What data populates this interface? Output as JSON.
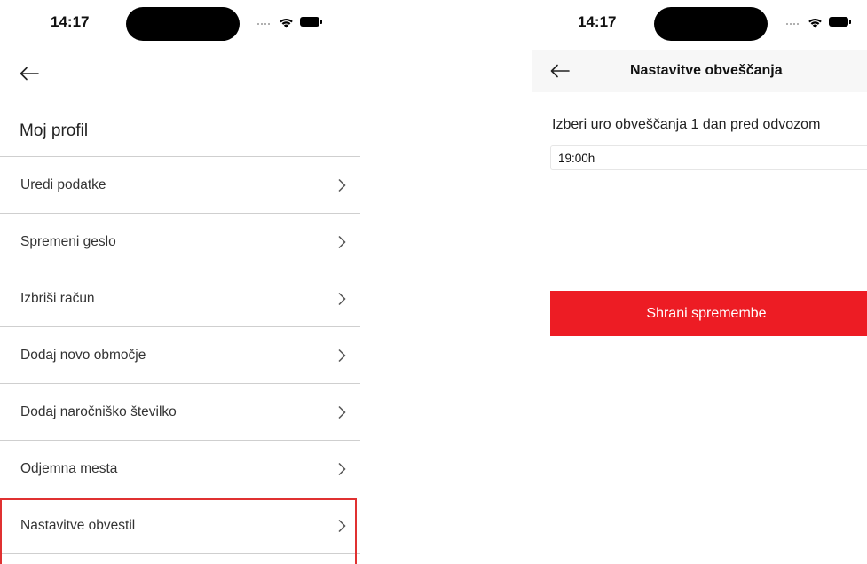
{
  "left": {
    "status": {
      "time": "14:17"
    },
    "title": "Moj profil",
    "menu": [
      {
        "label": "Uredi podatke"
      },
      {
        "label": "Spremeni geslo"
      },
      {
        "label": "Izbriši račun"
      },
      {
        "label": "Dodaj novo območje"
      },
      {
        "label": "Dodaj naročniško številko"
      },
      {
        "label": "Odjemna mesta"
      },
      {
        "label": "Nastavitve obvestil"
      }
    ]
  },
  "right": {
    "status": {
      "time": "14:17"
    },
    "nav_title": "Nastavitve obveščanja",
    "section_label": "Izberi uro obveščanja 1 dan pred odvozom",
    "time_value": "19:00h",
    "save_label": "Shrani spremembe"
  },
  "colors": {
    "accent_red": "#ed1c24",
    "highlight_red": "#e03131",
    "divider": "#cfcfcf"
  },
  "icons": [
    "back-arrow-icon",
    "chevron-right-icon",
    "wifi-icon",
    "battery-icon"
  ]
}
